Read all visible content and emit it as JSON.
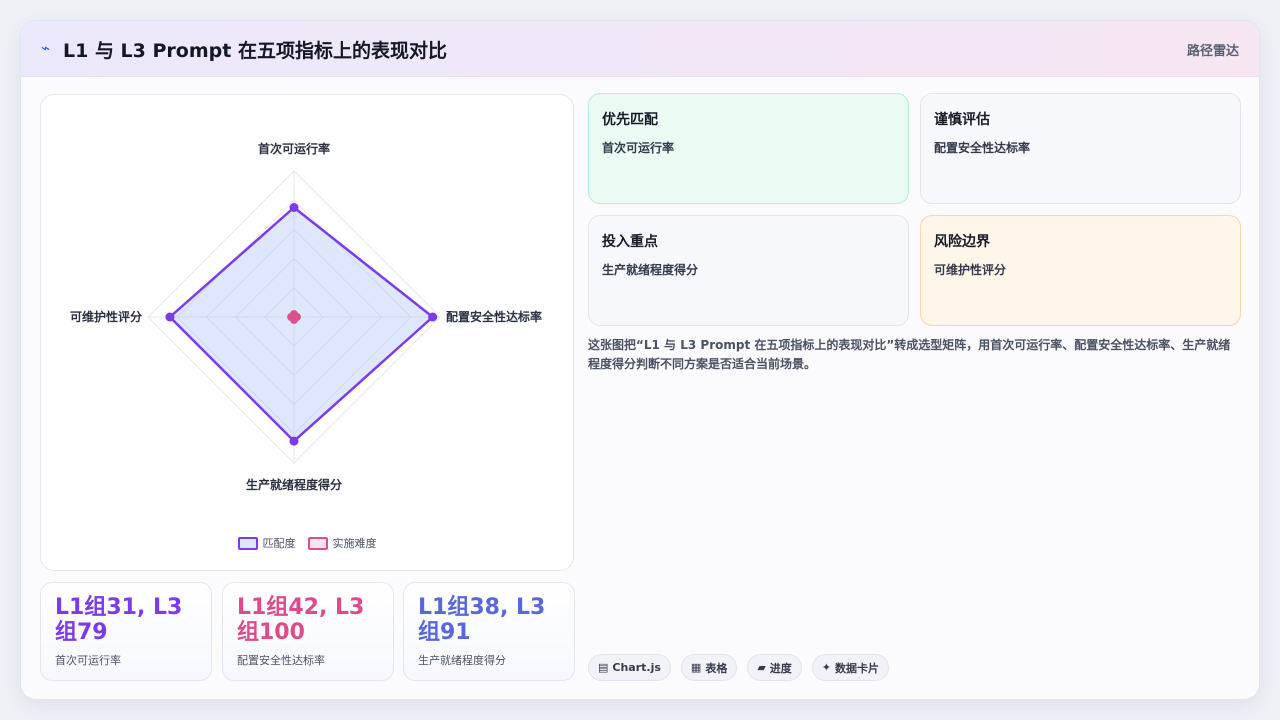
{
  "header": {
    "icon": "⌁",
    "title": "L1 与 L3 Prompt 在五项指标上的表现对比",
    "tag": "路径雷达"
  },
  "chart_data": {
    "type": "radar",
    "axes": [
      "首次可运行率",
      "配置安全性达标率",
      "生产就绪程度得分",
      "可维护性评分"
    ],
    "range": [
      0,
      100
    ],
    "series": [
      {
        "name": "匹配度",
        "values": [
          75,
          95,
          85,
          85
        ],
        "color": "#7c3aed"
      },
      {
        "name": "实施难度",
        "values": [
          2,
          2,
          2,
          2
        ],
        "color": "#db4f8f"
      }
    ],
    "grid_levels": 5,
    "legend_position": "bottom"
  },
  "stats": [
    {
      "value": "L1组31, L3组79",
      "label": "首次可运行率",
      "color": "#7c3aed"
    },
    {
      "value": "L1组42, L3组100",
      "label": "配置安全性达标率",
      "color": "#e04a8c"
    },
    {
      "value": "L1组38, L3组91",
      "label": "生产就绪程度得分",
      "color": "#5a67d8"
    }
  ],
  "quadrants": [
    {
      "title": "优先匹配",
      "text": "首次可运行率"
    },
    {
      "title": "谨慎评估",
      "text": "配置安全性达标率"
    },
    {
      "title": "投入重点",
      "text": "生产就绪程度得分"
    },
    {
      "title": "风险边界",
      "text": "可维护性评分"
    }
  ],
  "description": "这张图把“L1 与 L3 Prompt 在五项指标上的表现对比”转成选型矩阵，用首次可运行率、配置安全性达标率、生产就绪程度得分判断不同方案是否适合当前场景。",
  "chips": [
    {
      "icon": "▤",
      "label": "Chart.js"
    },
    {
      "icon": "▦",
      "label": "表格"
    },
    {
      "icon": "▰",
      "label": "进度"
    },
    {
      "icon": "✦",
      "label": "数据卡片"
    }
  ]
}
